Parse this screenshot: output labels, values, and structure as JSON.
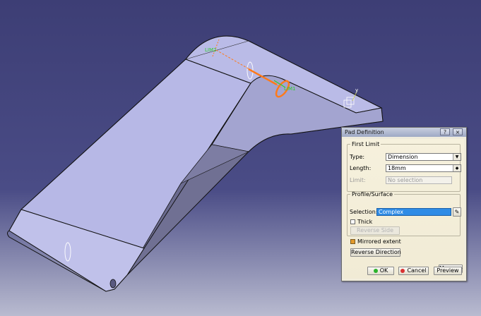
{
  "viewport": {
    "labels": {
      "lim2": "LIM2",
      "lim1": "LIM1",
      "axis_y": "y"
    },
    "colors": {
      "background_top": "#3d3e75",
      "part_face": "#b7b8e6",
      "part_dark": "#707093",
      "limit_green": "#2ecf2e",
      "arrow_orange": "#ff7a1a"
    }
  },
  "dialog": {
    "title": "Pad Definition",
    "help_label": "?",
    "close_label": "×",
    "first_limit": {
      "legend": "First Limit",
      "type_label": "Type:",
      "type_value": "Dimension",
      "length_label": "Length:",
      "length_value": "18mm",
      "limit_label": "Limit:",
      "limit_value": "No selection"
    },
    "profile_surface": {
      "legend": "Profile/Surface",
      "selection_label": "Selection:",
      "selection_value": "Complex",
      "thick_label": "Thick",
      "reverse_side_label": "Reverse Side"
    },
    "mirrored_label": "Mirrored extent",
    "reverse_direction_label": "Reverse Direction",
    "more_label": "More>>",
    "ok_label": "OK",
    "cancel_label": "Cancel",
    "preview_label": "Preview",
    "colors": {
      "ok_dot": "#2bb32b",
      "cancel_dot": "#d93131",
      "selection_highlight": "#2f8ce6",
      "mirrored_check": "#e49a2c"
    }
  }
}
